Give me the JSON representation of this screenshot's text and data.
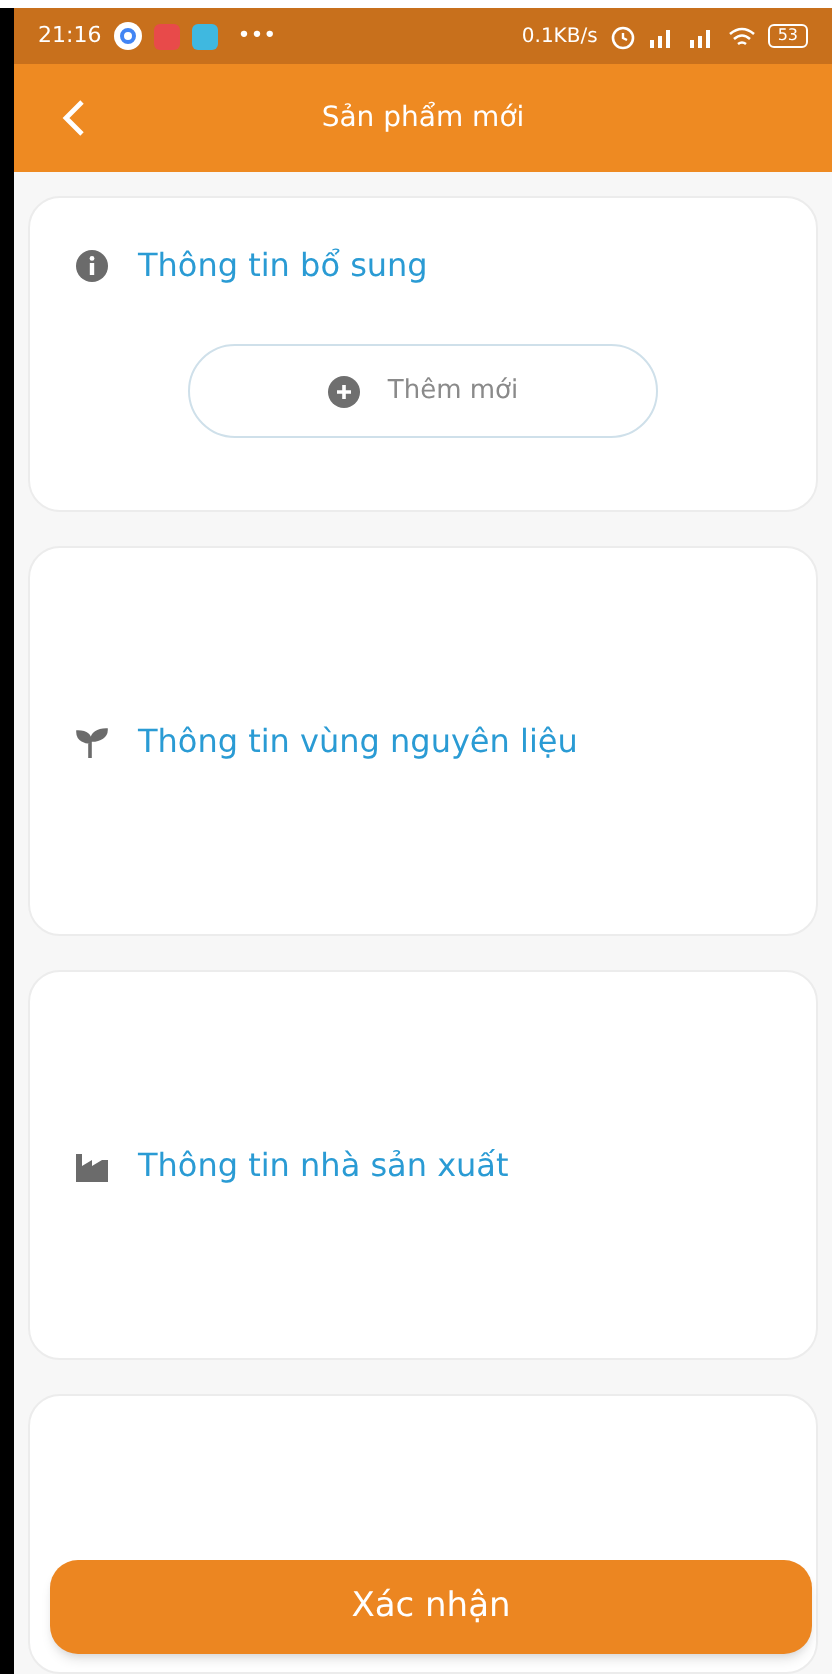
{
  "status_bar": {
    "time": "21:16",
    "more": "•••",
    "speed": "0.1KB/s",
    "battery": "53"
  },
  "header": {
    "title": "Sản phẩm mới"
  },
  "sections": [
    {
      "kind": "add",
      "title": "Thông tin bổ sung",
      "button": "Thêm mới"
    },
    {
      "kind": "plain",
      "title": "Thông tin vùng nguyên liệu"
    },
    {
      "kind": "plain",
      "title": "Thông tin nhà sản xuất"
    }
  ],
  "confirm_button": "Xác nhận"
}
